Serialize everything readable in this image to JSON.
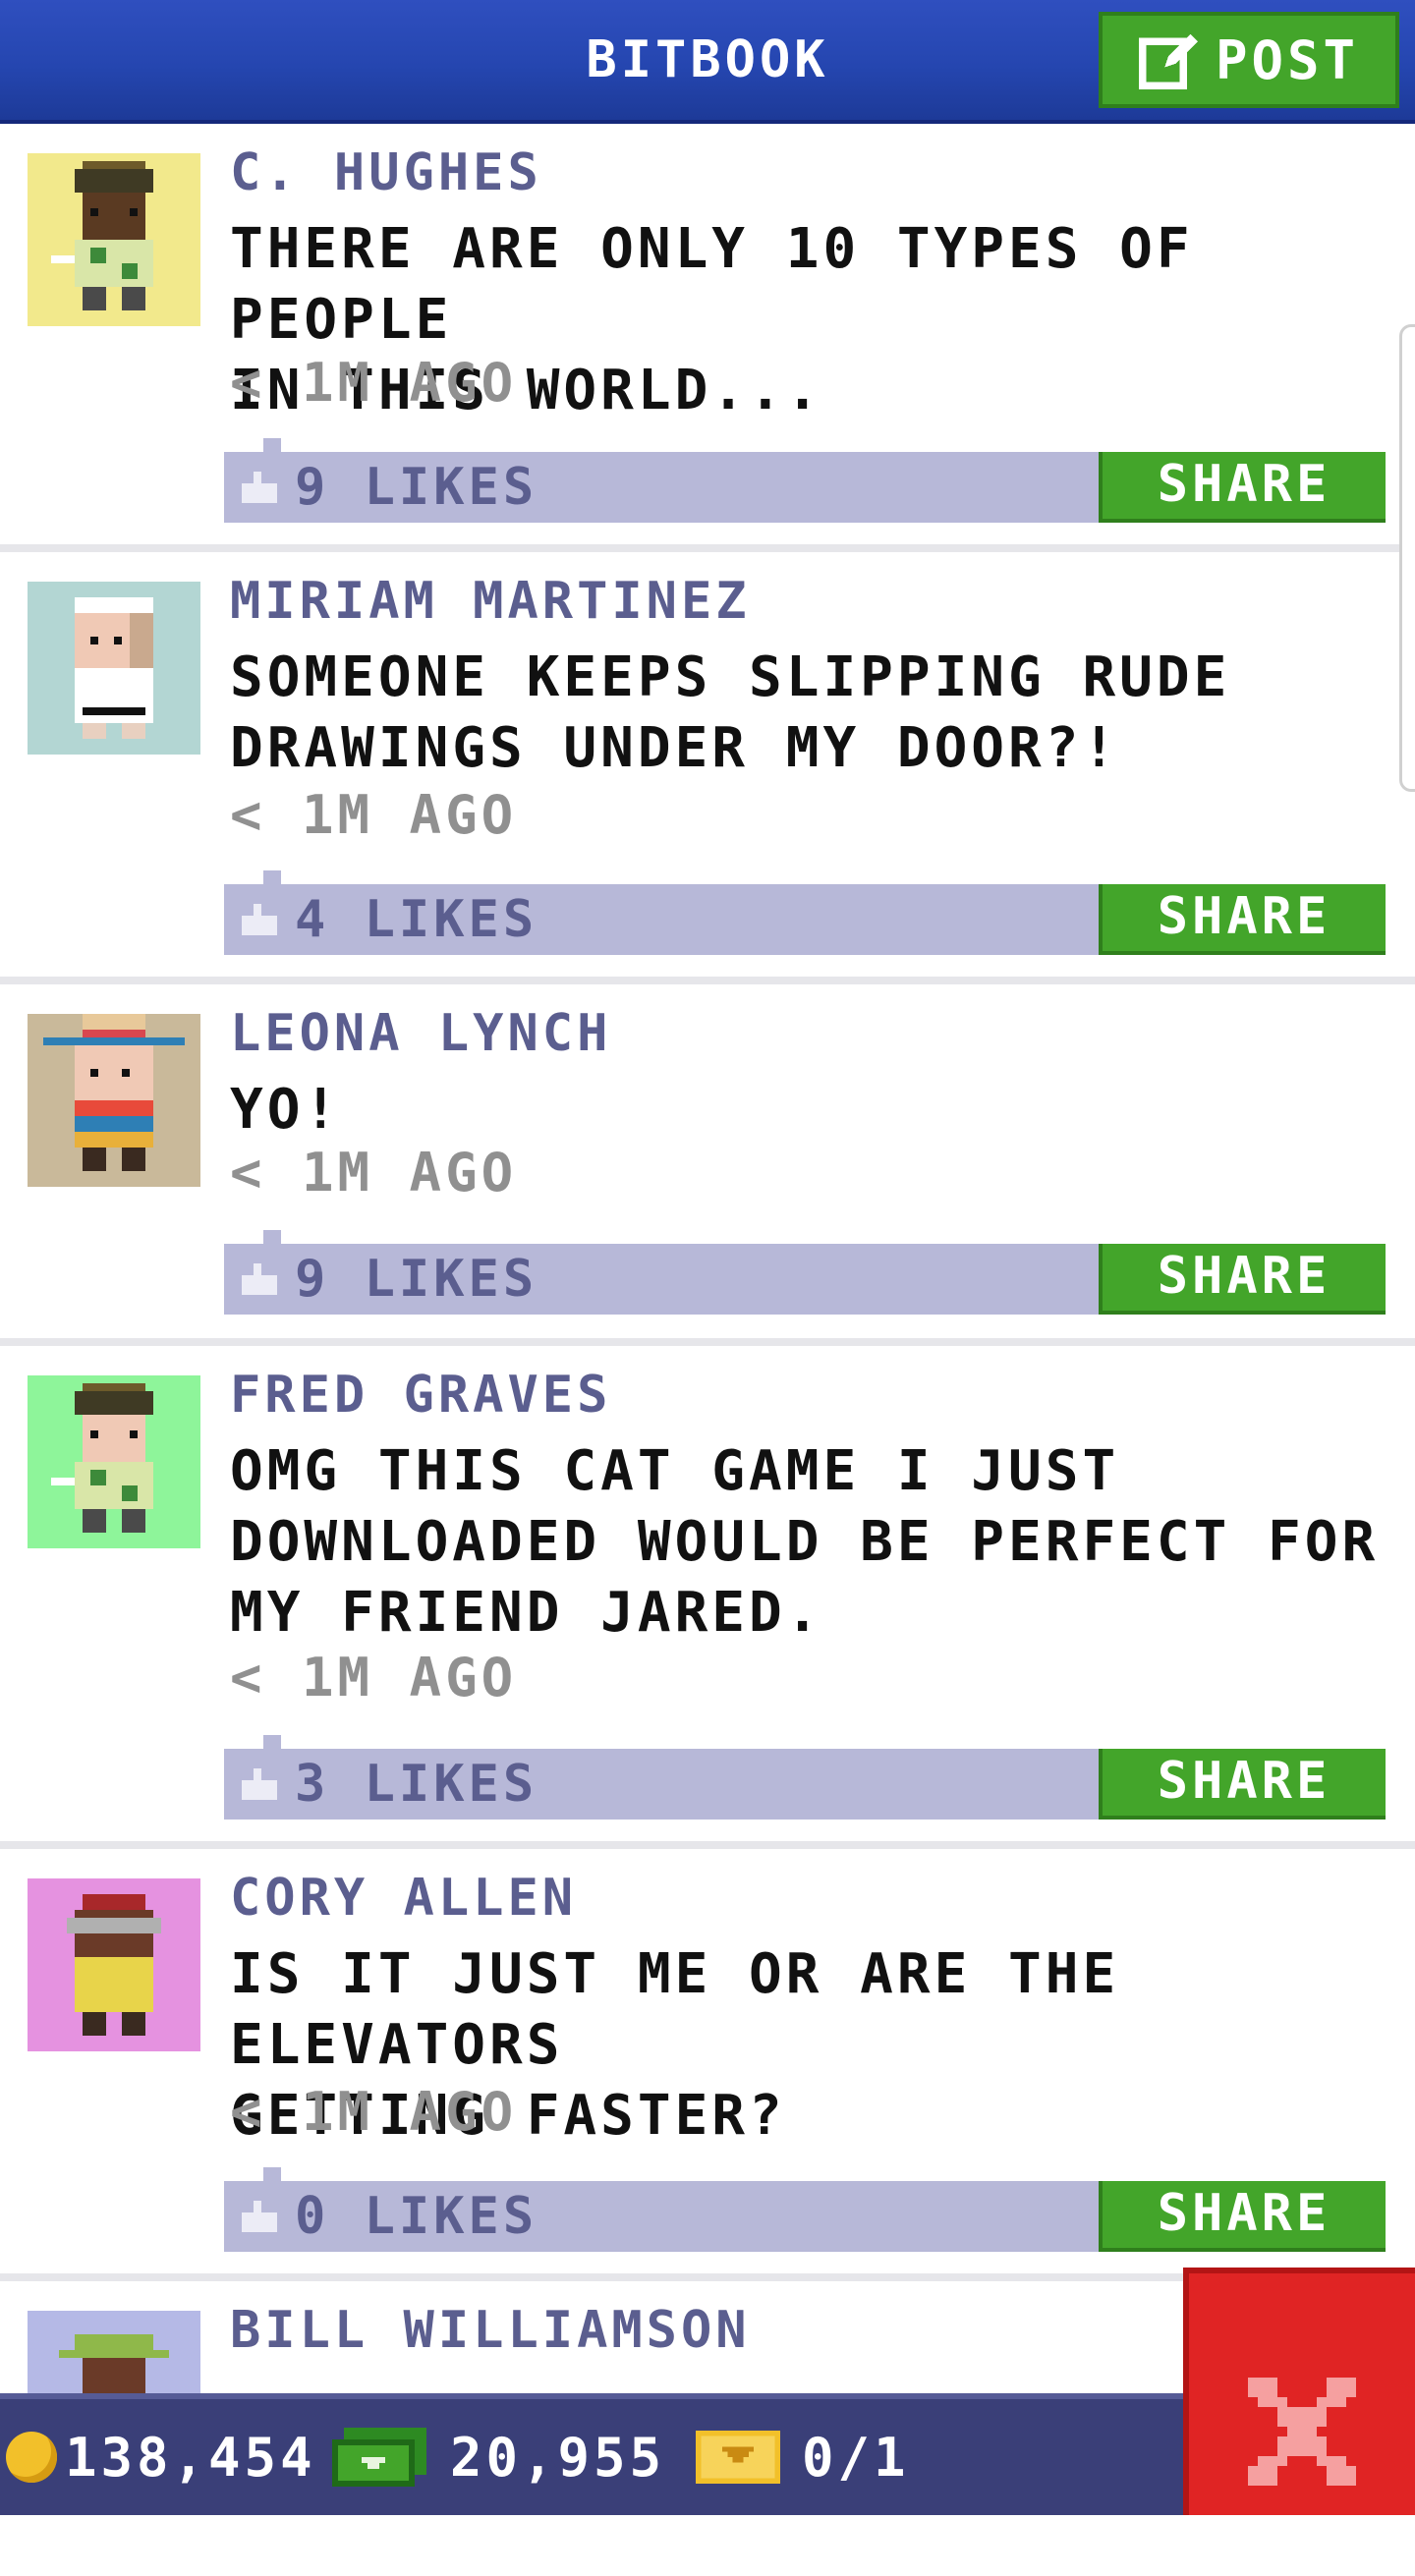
{
  "header": {
    "title": "BITBOOK",
    "post_label": "POST"
  },
  "posts": [
    {
      "author": "C. HUGHES",
      "message": "THERE ARE ONLY 10 TYPES OF PEOPLE\nIN THIS WORLD...",
      "time": "< 1M AGO",
      "likes": "9 LIKES",
      "share": "SHARE",
      "avatar_bg": "#f2e98c"
    },
    {
      "author": "MIRIAM MARTINEZ",
      "message": "SOMEONE KEEPS SLIPPING RUDE\nDRAWINGS UNDER MY DOOR?!",
      "time": "< 1M AGO",
      "likes": "4 LIKES",
      "share": "SHARE",
      "avatar_bg": "#b3d6d3"
    },
    {
      "author": "LEONA LYNCH",
      "message": "YO!",
      "time": "< 1M AGO",
      "likes": "9 LIKES",
      "share": "SHARE",
      "avatar_bg": "#c9b99a"
    },
    {
      "author": "FRED GRAVES",
      "message": "OMG THIS CAT GAME I JUST\nDOWNLOADED WOULD BE PERFECT FOR\nMY FRIEND JARED.",
      "time": "< 1M AGO",
      "likes": "3 LIKES",
      "share": "SHARE",
      "avatar_bg": "#8ef59a"
    },
    {
      "author": "CORY ALLEN",
      "message": "IS IT JUST ME OR ARE THE ELEVATORS\nGETTING FASTER?",
      "time": "< 1M AGO",
      "likes": "0 LIKES",
      "share": "SHARE",
      "avatar_bg": "#e592e0"
    },
    {
      "author": "BILL WILLIAMSON",
      "avatar_bg": "#b5b9e6"
    }
  ],
  "status": {
    "coins": "138,454",
    "cash": "20,955",
    "tickets": "0/1"
  },
  "colors": {
    "header_blue": "#2546b0",
    "share_green": "#43a52a",
    "like_bar": "#b7b8d8",
    "close_red": "#e02424"
  }
}
